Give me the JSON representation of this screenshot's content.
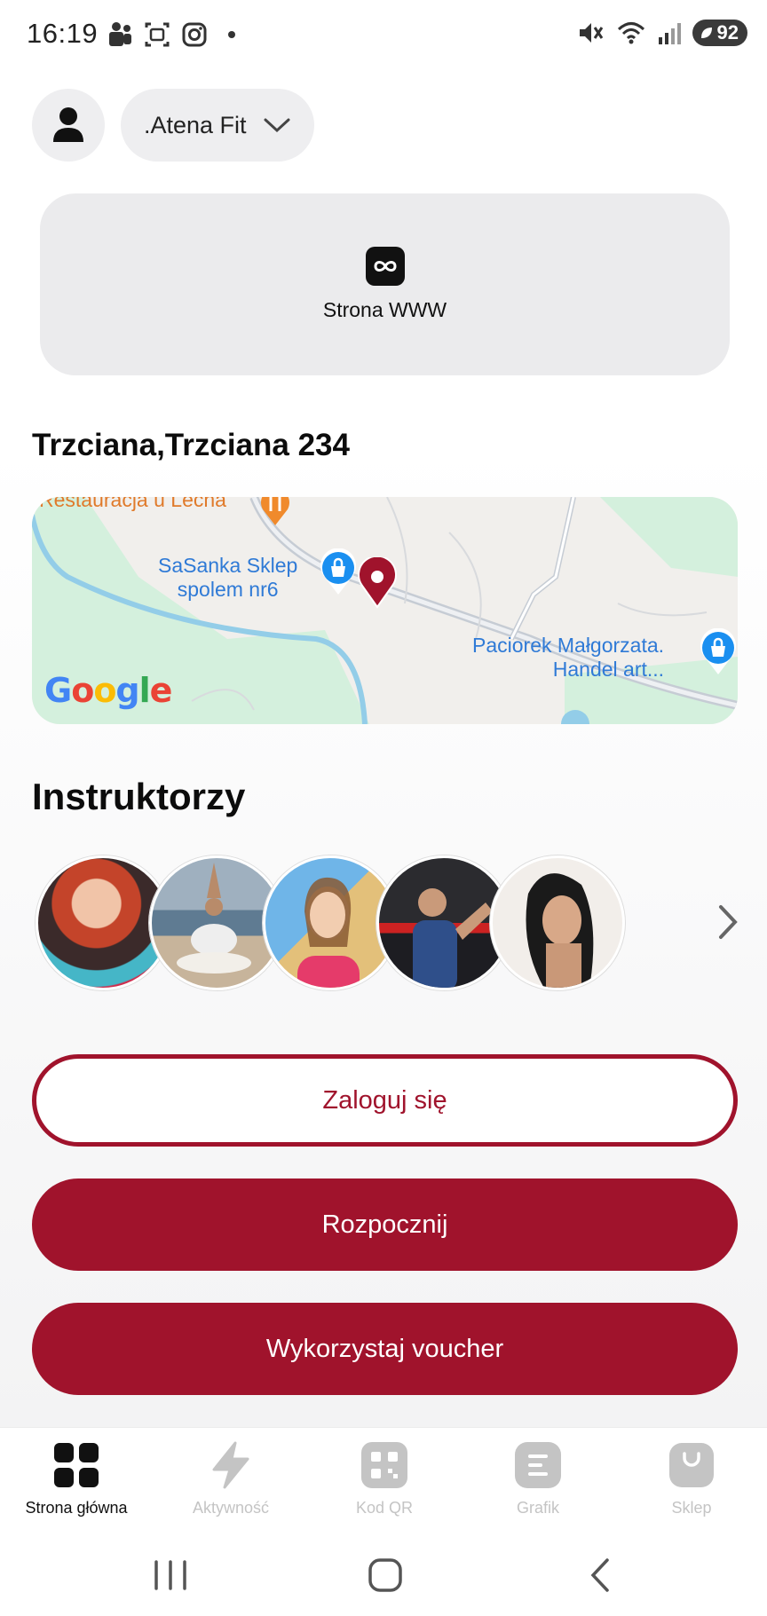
{
  "status_bar": {
    "time": "16:19",
    "battery": "92",
    "left_icons": [
      "teams-icon",
      "screenshot-icon",
      "instagram-icon",
      "dot-icon"
    ],
    "right_icons": [
      "vibrate-mute-icon",
      "wifi-icon",
      "signal-icon"
    ]
  },
  "header": {
    "club_name": ".Atena Fit"
  },
  "website_card": {
    "label": "Strona WWW",
    "icon": "link-icon"
  },
  "location": {
    "address": "Trzciana,Trzciana 234",
    "map": {
      "places": [
        {
          "name": "Restauracja u Lecha",
          "kind": "restaurant"
        },
        {
          "name": "SaSanka Sklep\nspolem nr6",
          "kind": "shop"
        },
        {
          "name": "Paciorek Małgorzata.\nHandel art...",
          "kind": "shop"
        }
      ],
      "logo_text": "Google"
    }
  },
  "instructors": {
    "title": "Instruktorzy",
    "count_shown": 5
  },
  "buttons": {
    "login": "Zaloguj się",
    "start": "Rozpocznij",
    "voucher": "Wykorzystaj voucher"
  },
  "bottom_nav": {
    "items": [
      {
        "label": "Strona główna",
        "icon": "dashboard-icon",
        "active": true
      },
      {
        "label": "Aktywność",
        "icon": "lightning-icon",
        "active": false
      },
      {
        "label": "Kod QR",
        "icon": "qr-code-icon",
        "active": false
      },
      {
        "label": "Grafik",
        "icon": "schedule-icon",
        "active": false
      },
      {
        "label": "Sklep",
        "icon": "shopping-bag-icon",
        "active": false
      }
    ]
  },
  "colors": {
    "accent": "#a0132c",
    "card_bg": "#ebebed",
    "inactive": "#c4c4c4"
  }
}
